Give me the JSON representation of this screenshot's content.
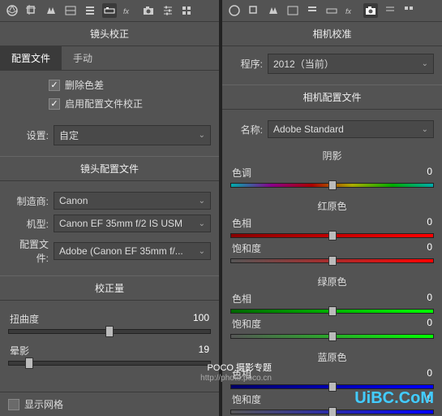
{
  "left": {
    "title": "镜头校正",
    "tabs": {
      "profile": "配置文件",
      "manual": "手动"
    },
    "checks": {
      "removeCA": "删除色差",
      "enableProfile": "启用配置文件校正"
    },
    "setup": {
      "label": "设置:",
      "value": "自定"
    },
    "profileSection": "镜头配置文件",
    "maker": {
      "label": "制造商:",
      "value": "Canon"
    },
    "model": {
      "label": "机型:",
      "value": "Canon EF 35mm f/2 IS USM"
    },
    "profile": {
      "label": "配置文件:",
      "value": "Adobe (Canon EF 35mm f/..."
    },
    "correctionSection": "校正量",
    "distortion": {
      "label": "扭曲度",
      "value": "100"
    },
    "vignette": {
      "label": "晕影",
      "value": "19"
    },
    "showGrid": "显示网格"
  },
  "right": {
    "title": "相机校准",
    "process": {
      "label": "程序:",
      "value": "2012（当前）"
    },
    "cameraProfileSection": "相机配置文件",
    "name": {
      "label": "名称:",
      "value": "Adobe Standard"
    },
    "shadows": "阴影",
    "hueLabel": "色调",
    "redPrimary": "红原色",
    "greenPrimary": "绿原色",
    "bluePrimary": "蓝原色",
    "hue": "色相",
    "saturation": "饱和度",
    "zero": "0"
  },
  "watermark": {
    "poco": "POCO 摄影专题",
    "url": "http://photo.poco.cn",
    "brand": "UiBC.CoM"
  }
}
